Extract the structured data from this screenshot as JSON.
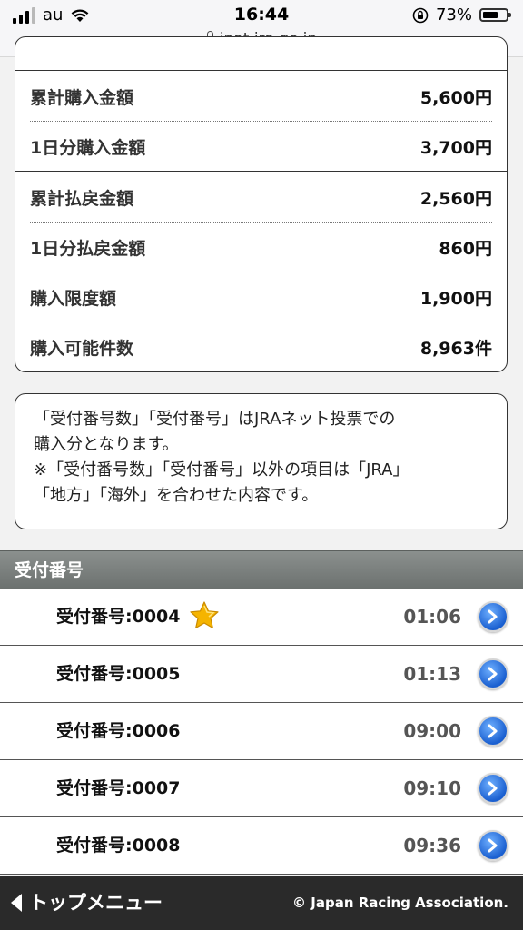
{
  "status_bar": {
    "carrier": "au",
    "time": "16:44",
    "battery_percent": "73%",
    "battery_level": 0.73,
    "url": "ipat.jra.go.jp"
  },
  "summary": {
    "rows": [
      {
        "label": "累計購入金額",
        "value": "5,600円"
      },
      {
        "label": "1日分購入金額",
        "value": "3,700円"
      },
      {
        "label": "累計払戻金額",
        "value": "2,560円"
      },
      {
        "label": "1日分払戻金額",
        "value": "860円"
      },
      {
        "label": "購入限度額",
        "value": "1,900円"
      },
      {
        "label": "購入可能件数",
        "value": "8,963件"
      }
    ]
  },
  "notice": {
    "line1": "「受付番号数」「受付番号」はJRAネット投票での",
    "line2": "購入分となります。",
    "line3": "※「受付番号数」「受付番号」以外の項目は「JRA」",
    "line4": "「地方」「海外」を合わせた内容です。"
  },
  "receipts": {
    "header": "受付番号",
    "items": [
      {
        "label": "受付番号:0004",
        "time": "01:06",
        "starred": true
      },
      {
        "label": "受付番号:0005",
        "time": "01:13",
        "starred": false
      },
      {
        "label": "受付番号:0006",
        "time": "09:00",
        "starred": false
      },
      {
        "label": "受付番号:0007",
        "time": "09:10",
        "starred": false
      },
      {
        "label": "受付番号:0008",
        "time": "09:36",
        "starred": false
      }
    ]
  },
  "footer": {
    "back_label": "トップメニュー",
    "copyright": "© Japan Racing Association."
  },
  "colors": {
    "accent_blue": "#1a5fd0",
    "star": "#f5b400",
    "footer_bg": "#2a2a2a",
    "section_header_bg": "#7a7f7d"
  }
}
